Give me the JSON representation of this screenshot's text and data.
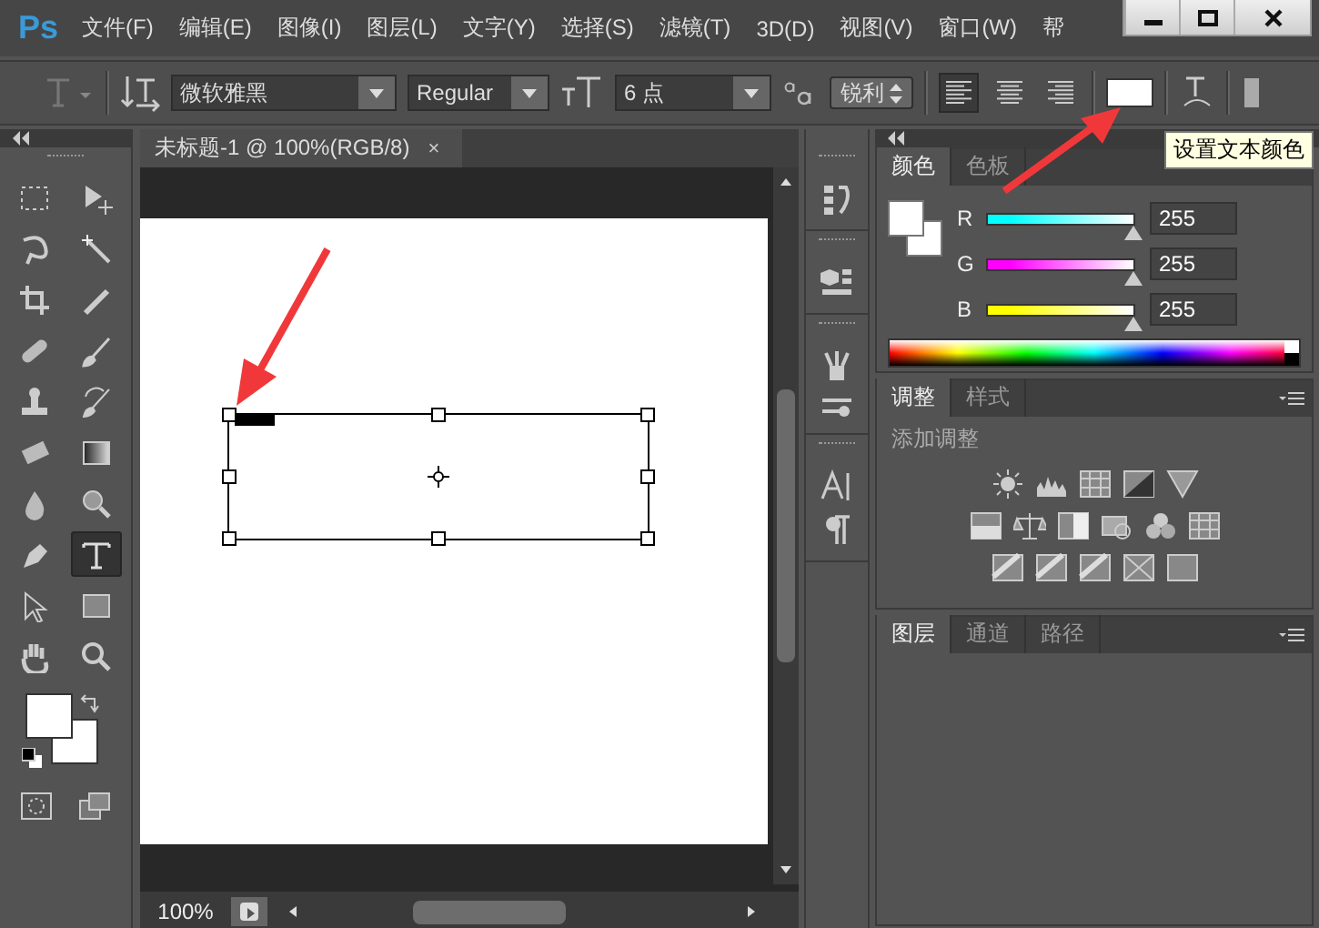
{
  "app": {
    "logo": "Ps"
  },
  "menu": [
    "文件(F)",
    "编辑(E)",
    "图像(I)",
    "图层(L)",
    "文字(Y)",
    "选择(S)",
    "滤镜(T)",
    "3D(D)",
    "视图(V)",
    "窗口(W)",
    "帮"
  ],
  "options_bar": {
    "font_family": "微软雅黑",
    "font_style": "Regular",
    "font_size": "6 点",
    "antialias": "锐利",
    "align": [
      {
        "selected": true
      },
      {
        "selected": false
      },
      {
        "selected": false
      }
    ]
  },
  "tooltip": "设置文本颜色",
  "tools": [
    {
      "selected": false
    },
    {
      "selected": false
    },
    {
      "selected": false
    },
    {
      "selected": false
    },
    {
      "selected": false
    },
    {
      "selected": false
    },
    {
      "selected": false
    },
    {
      "selected": false
    },
    {
      "selected": false
    },
    {
      "selected": false
    },
    {
      "selected": false
    },
    {
      "selected": false
    },
    {
      "selected": false
    },
    {
      "selected": false
    },
    {
      "selected": false
    },
    {
      "selected": true
    },
    {
      "selected": false
    },
    {
      "selected": false
    },
    {
      "selected": false
    },
    {
      "selected": false
    }
  ],
  "document": {
    "tab": "未标题-1 @ 100%(RGB/8)",
    "close": "×",
    "zoom": "100%"
  },
  "color_panel": {
    "tabs": [
      {
        "label": "颜色",
        "selected": true
      },
      {
        "label": "色板",
        "selected": false
      }
    ],
    "channels": [
      {
        "name": "R",
        "color": "#00ffff",
        "level": 1,
        "value": "255"
      },
      {
        "name": "G",
        "color": "#ff00ff",
        "level": 1,
        "value": "255"
      },
      {
        "name": "B",
        "color": "#ffff00",
        "level": 1,
        "value": "255"
      }
    ]
  },
  "adjustments_panel": {
    "tabs": [
      {
        "label": "调整",
        "selected": true
      },
      {
        "label": "样式",
        "selected": false
      }
    ],
    "heading": "添加调整"
  },
  "layers_panel": {
    "tabs": [
      {
        "label": "图层",
        "selected": true
      },
      {
        "label": "通道",
        "selected": false
      },
      {
        "label": "路径",
        "selected": false
      }
    ]
  }
}
